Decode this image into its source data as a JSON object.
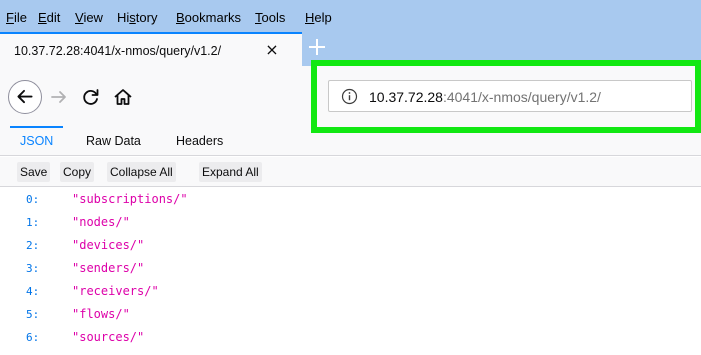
{
  "menu": {
    "items": [
      {
        "accel": "F",
        "rest": "ile"
      },
      {
        "accel": "E",
        "rest": "dit"
      },
      {
        "accel": "V",
        "rest": "iew"
      },
      {
        "pre": "Hi",
        "accel": "s",
        "rest": "tory"
      },
      {
        "accel": "B",
        "rest": "ookmarks"
      },
      {
        "accel": "T",
        "rest": "ools"
      },
      {
        "accel": "H",
        "rest": "elp"
      }
    ]
  },
  "tab": {
    "title": "10.37.72.28:4041/x-nmos/query/v1.2/",
    "close": "×"
  },
  "nav": {
    "url_host": "10.37.72.28",
    "url_rest": ":4041/x-nmos/query/v1.2/"
  },
  "viewer": {
    "tabs": [
      "JSON",
      "Raw Data",
      "Headers"
    ],
    "selected": "JSON"
  },
  "toolbar": {
    "save": "Save",
    "copy": "Copy",
    "collapse_all": "Collapse All",
    "expand_all": "Expand All"
  },
  "json_rows": [
    {
      "key": "0:",
      "value": "\"subscriptions/\""
    },
    {
      "key": "1:",
      "value": "\"nodes/\""
    },
    {
      "key": "2:",
      "value": "\"devices/\""
    },
    {
      "key": "3:",
      "value": "\"senders/\""
    },
    {
      "key": "4:",
      "value": "\"receivers/\""
    },
    {
      "key": "5:",
      "value": "\"flows/\""
    },
    {
      "key": "6:",
      "value": "\"sources/\""
    }
  ],
  "colors": {
    "menubar_bg": "#a8c9ef",
    "accent": "#0a84ff",
    "highlight": "#12e812",
    "json_key": "#0074e8",
    "json_string": "#dd00a9"
  }
}
